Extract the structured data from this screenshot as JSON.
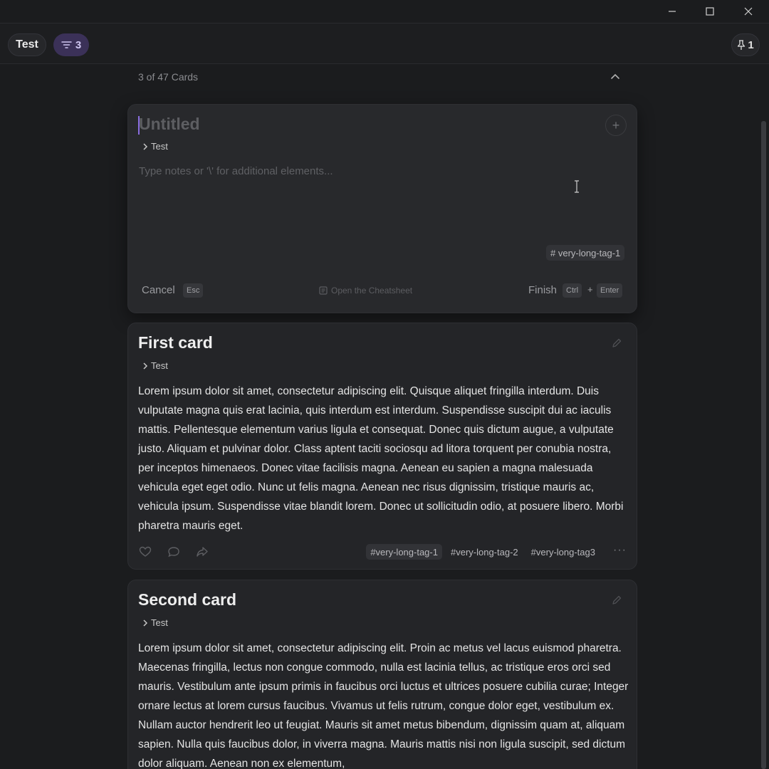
{
  "window": {
    "minimize_icon": "minimize-icon",
    "maximize_icon": "maximize-icon",
    "close_icon": "close-icon"
  },
  "topbar": {
    "board_name": "Test",
    "filter_count": "3",
    "pinned_count": "1"
  },
  "list": {
    "header": "3 of 47 Cards"
  },
  "editor": {
    "title_placeholder": "Untitled",
    "breadcrumb": "Test",
    "notes_placeholder": "Type notes or '\\' for additional elements...",
    "tag": "very-long-tag-1",
    "cancel_label": "Cancel",
    "cancel_key": "Esc",
    "cheatsheet_label": "Open the Cheatsheet",
    "finish_label": "Finish",
    "finish_key_1": "Ctrl",
    "finish_plus": "+",
    "finish_key_2": "Enter"
  },
  "cards": [
    {
      "title": "First card",
      "breadcrumb": "Test",
      "body": "Lorem ipsum dolor sit amet, consectetur adipiscing elit. Quisque aliquet fringilla interdum. Duis vulputate magna quis erat lacinia, quis interdum est interdum. Suspendisse suscipit dui ac iaculis mattis. Pellentesque elementum varius ligula et consequat. Donec quis dictum augue, a vulputate justo. Aliquam et pulvinar dolor. Class aptent taciti sociosqu ad litora torquent per conubia nostra, per inceptos himenaeos. Donec vitae facilisis magna. Aenean eu sapien a magna malesuada vehicula eget eget odio. Nunc ut felis magna. Aenean nec risus dignissim, tristique mauris ac, vehicula ipsum. Suspendisse vitae blandit lorem. Donec ut sollicitudin odio, at posuere libero. Morbi pharetra mauris eget.",
      "tags": [
        "very-long-tag-1",
        "very-long-tag-2",
        "very-long-tag3"
      ]
    },
    {
      "title": "Second card",
      "breadcrumb": "Test",
      "body": "Lorem ipsum dolor sit amet, consectetur adipiscing elit. Proin ac metus vel lacus euismod pharetra. Maecenas fringilla, lectus non congue commodo, nulla est lacinia tellus, ac tristique eros orci sed mauris. Vestibulum ante ipsum primis in faucibus orci luctus et ultrices posuere cubilia curae; Integer ornare lectus at lorem cursus faucibus. Vivamus ut felis rutrum, congue dolor eget, vestibulum ex. Nullam auctor hendrerit leo ut feugiat. Mauris sit amet metus bibendum, dignissim quam at, aliquam sapien. Nulla quis faucibus dolor, in viverra magna. Mauris mattis nisi non ligula suscipit, sed dictum dolor aliquam. Aenean non ex elementum,"
    }
  ]
}
